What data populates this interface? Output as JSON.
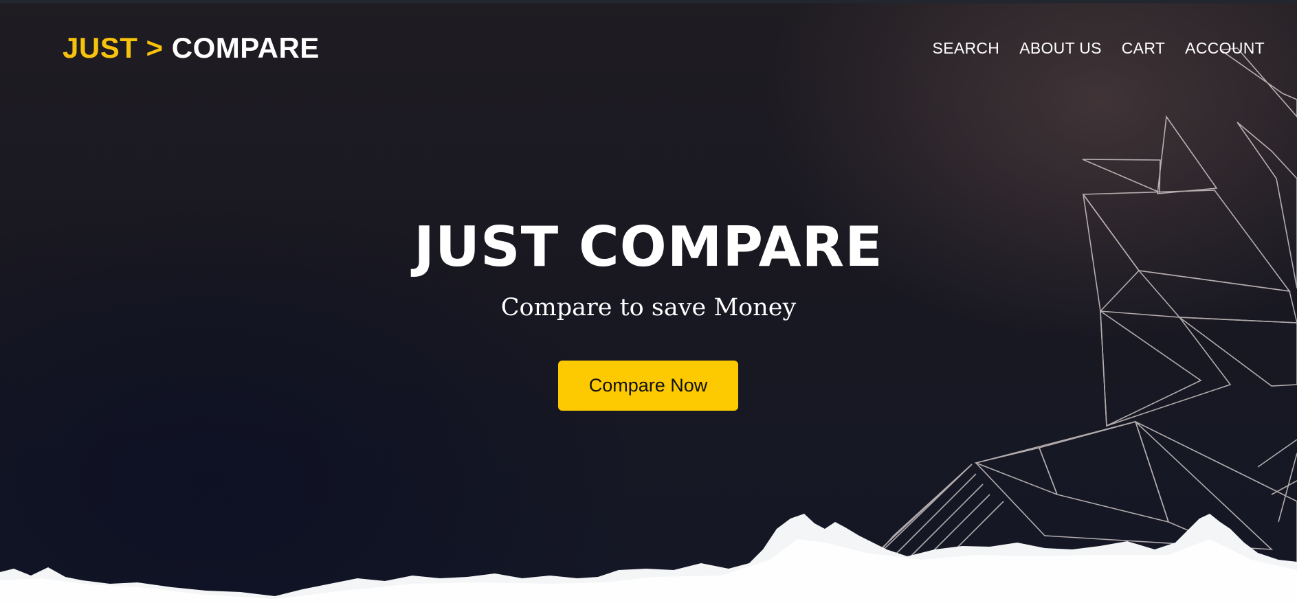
{
  "brand": {
    "part1": "JUST >",
    "part2": "COMPARE",
    "accent_color": "#f7c20d"
  },
  "nav": {
    "items": [
      {
        "label": "SEARCH"
      },
      {
        "label": "ABOUT US"
      },
      {
        "label": "CART"
      },
      {
        "label": "ACCOUNT"
      }
    ]
  },
  "hero": {
    "title": "JUST COMPARE",
    "subtitle": "Compare to save Money",
    "cta_label": "Compare Now",
    "cta_color": "#fdc900"
  },
  "decor": {
    "right_art": "geometric-wireframe-mountain",
    "bottom_art": "snow-ridge"
  }
}
